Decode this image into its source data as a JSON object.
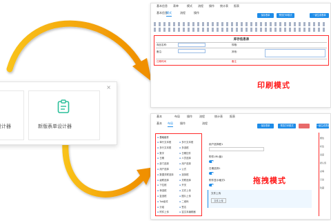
{
  "picker": {
    "old_label": "设计器",
    "new_label": "新版表单设计器",
    "close_glyph": "×",
    "icon": "form-clipboard-icon"
  },
  "print_panel": {
    "tabs": [
      "基本信息",
      "表单",
      "模式",
      "流程",
      "操作",
      "统计表",
      "报表"
    ],
    "active_tab": 2,
    "buttons": [
      "保存表单",
      "预览打印模式",
      "一键生成表单"
    ],
    "doc_title": "库存信息表",
    "form_labels": [
      "商品名称:",
      "规格:",
      "备注:",
      "其他:"
    ],
    "form_red_left": "日期时间",
    "form_red_right": "备注",
    "mode_label": "印刷模式"
  },
  "drag_panel": {
    "tabs": [
      "基本",
      "布局",
      "操作",
      "流程",
      "统计表",
      "报表"
    ],
    "active_tab": 1,
    "buttons": [
      "保存表单",
      "预览打印模式",
      "一键生成表单"
    ],
    "components_title": "基础组件",
    "components_left": [
      "单行文本框",
      "多行文本框",
      "数字",
      "日期",
      "部门选择",
      "用户选择",
      "数据关联选择",
      "级联选择",
      "下拉框",
      "单选框",
      "复选框",
      "Tab组件",
      "分组",
      "附件上传"
    ],
    "components_right": [
      "多行文本框",
      "多选框",
      "日期控件",
      "人员选择",
      "用户选择",
      "公式",
      "选择框",
      "关联选择",
      "开关",
      "文件上传",
      "图片上传",
      "二维码",
      "签名",
      "富文本编辑器"
    ],
    "fields": [
      "用户选择框1",
      "附件URL值1",
      "日期选择1",
      "附件显示格式1",
      "文件上传"
    ],
    "upload_button": "文件上传",
    "mode_label": "拖拽模式",
    "right_items": [
      "属性",
      "标签",
      "宽度",
      "默认值",
      "必填",
      "只读",
      "隐藏"
    ]
  },
  "colors": {
    "arrow": "#f5a800",
    "accent": "#1e8ce8",
    "highlight": "#ff1a1a"
  }
}
